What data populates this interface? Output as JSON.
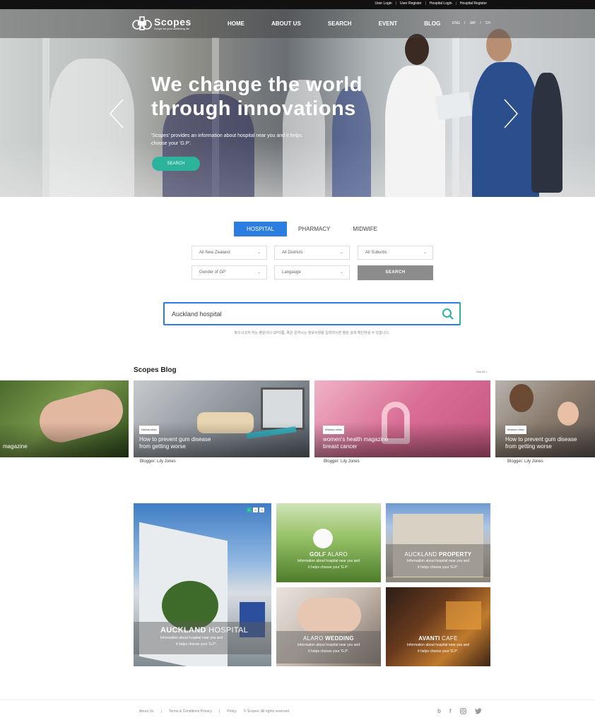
{
  "util_links": [
    "User Login",
    "User Register",
    "Hospital Login",
    "Hospital Register"
  ],
  "brand": {
    "name": "Scopes",
    "tagline": "Scope for your wellbeing life"
  },
  "nav": [
    "HOME",
    "ABOUT US",
    "SEARCH",
    "EVENT",
    "BLOG"
  ],
  "lang": [
    "ENG",
    "/",
    "JAP",
    "/",
    "CH"
  ],
  "hero": {
    "title_line1": "We change the world",
    "title_line2": "through innovations",
    "subtitle": "'Scopes' provides an information about hospital near you and it helps choose your 'G.P'.",
    "button": "SEARCH"
  },
  "search": {
    "tabs": [
      "HOSPITAL",
      "PHARMACY",
      "MIDWIFE"
    ],
    "active_tab": "HOSPITAL",
    "selects": [
      "All New Zealand",
      "All Districts",
      "All Suburbs",
      "Gender of GP",
      "Langauge"
    ],
    "button": "SEARCH",
    "query": "Auckland hospital",
    "hint": "찾으시고자 하는 병원이나 GP이름, 혹은 원하시는 정보사항을 입력하시면 병원 검색 확인하실 수 있습니다."
  },
  "blog": {
    "title": "Scopes Blog",
    "see_all": "See All >",
    "cards": [
      {
        "badge": "",
        "title1": "magazine",
        "title2": "",
        "blogger": ""
      },
      {
        "badge": "Dental clinic",
        "title1": "How to prevent gum disease",
        "title2": "from getting worse",
        "blogger": "Blogger: Lily Jones"
      },
      {
        "badge": "Woman clinic",
        "title1": "women's health magazine",
        "title2": "breast cancer",
        "blogger": "Blogger: Lily Jones"
      },
      {
        "badge": "Woman clinic",
        "title1": "How to prevent gum disease",
        "title2": "from getting worse",
        "blogger": "Blogger: Lily Jones"
      }
    ]
  },
  "gallery": {
    "pager": [
      "1",
      "2",
      "3"
    ],
    "main": {
      "bold": "AUCKLAND",
      "rest": " HOSPITAL",
      "desc1": "Information about hospital near you and",
      "desc2": "it helps choose your 'G.P'."
    },
    "tiles": [
      {
        "bold": "GOLF",
        "rest": " ALARO",
        "desc1": "Information about hospital near you and",
        "desc2": "it helps choose your 'G.P'."
      },
      {
        "bold": "AUCKLAND",
        "rest": " PROPERTY",
        "desc1": "Information about hospital near you and",
        "desc2": "it helps choose your 'G.P'."
      },
      {
        "bold": "ALARO",
        "rest": " WEDDING",
        "desc1": "Information about hospital near you and",
        "desc2": "it helps choose your 'G.P'."
      },
      {
        "bold": "AVANTI",
        "rest": " CAFE",
        "desc1": "Information about hospital near you and",
        "desc2": "it helps choose your 'G.P'."
      }
    ]
  },
  "footer": {
    "links": [
      "About Us",
      "|",
      "Terms & Conditions Privacy",
      "|",
      "Policy",
      "© Scopes. All rights reserved."
    ],
    "social": [
      "b",
      "f",
      "ig",
      "tw"
    ]
  },
  "colors": {
    "accent_blue": "#2b7de0",
    "accent_teal": "#2bb39c"
  }
}
